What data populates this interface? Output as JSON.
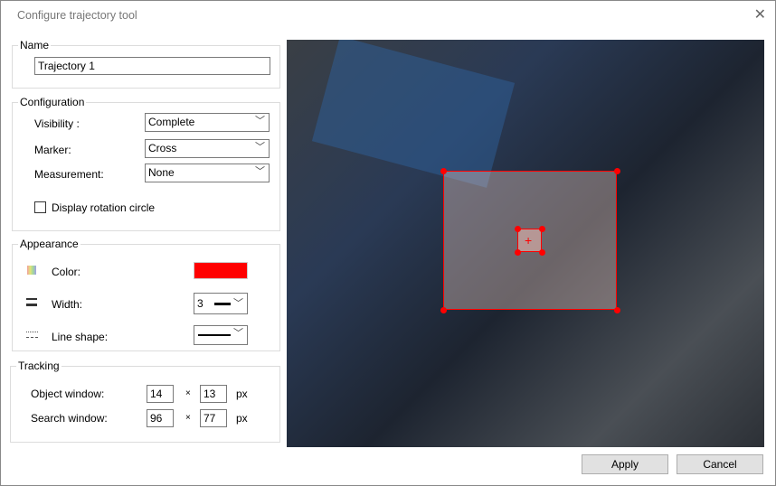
{
  "window": {
    "title": "Configure trajectory tool",
    "close_icon": "close-icon"
  },
  "name_group": {
    "label": "Name",
    "value": "Trajectory 1"
  },
  "configuration": {
    "label": "Configuration",
    "visibility_label": "Visibility :",
    "visibility_value": "Complete",
    "marker_label": "Marker:",
    "marker_value": "Cross",
    "measurement_label": "Measurement:",
    "measurement_value": "None",
    "rotation_checkbox_label": "Display rotation circle",
    "rotation_checked": false
  },
  "appearance": {
    "label": "Appearance",
    "color_label": "Color:",
    "color_value": "#ff0000",
    "width_label": "Width:",
    "width_value": "3",
    "line_shape_label": "Line shape:"
  },
  "tracking": {
    "label": "Tracking",
    "object_window_label": "Object window:",
    "object_w": "14",
    "object_h": "13",
    "search_window_label": "Search window:",
    "search_w": "96",
    "search_h": "77",
    "times": "×",
    "unit": "px"
  },
  "buttons": {
    "apply": "Apply",
    "cancel": "Cancel"
  }
}
